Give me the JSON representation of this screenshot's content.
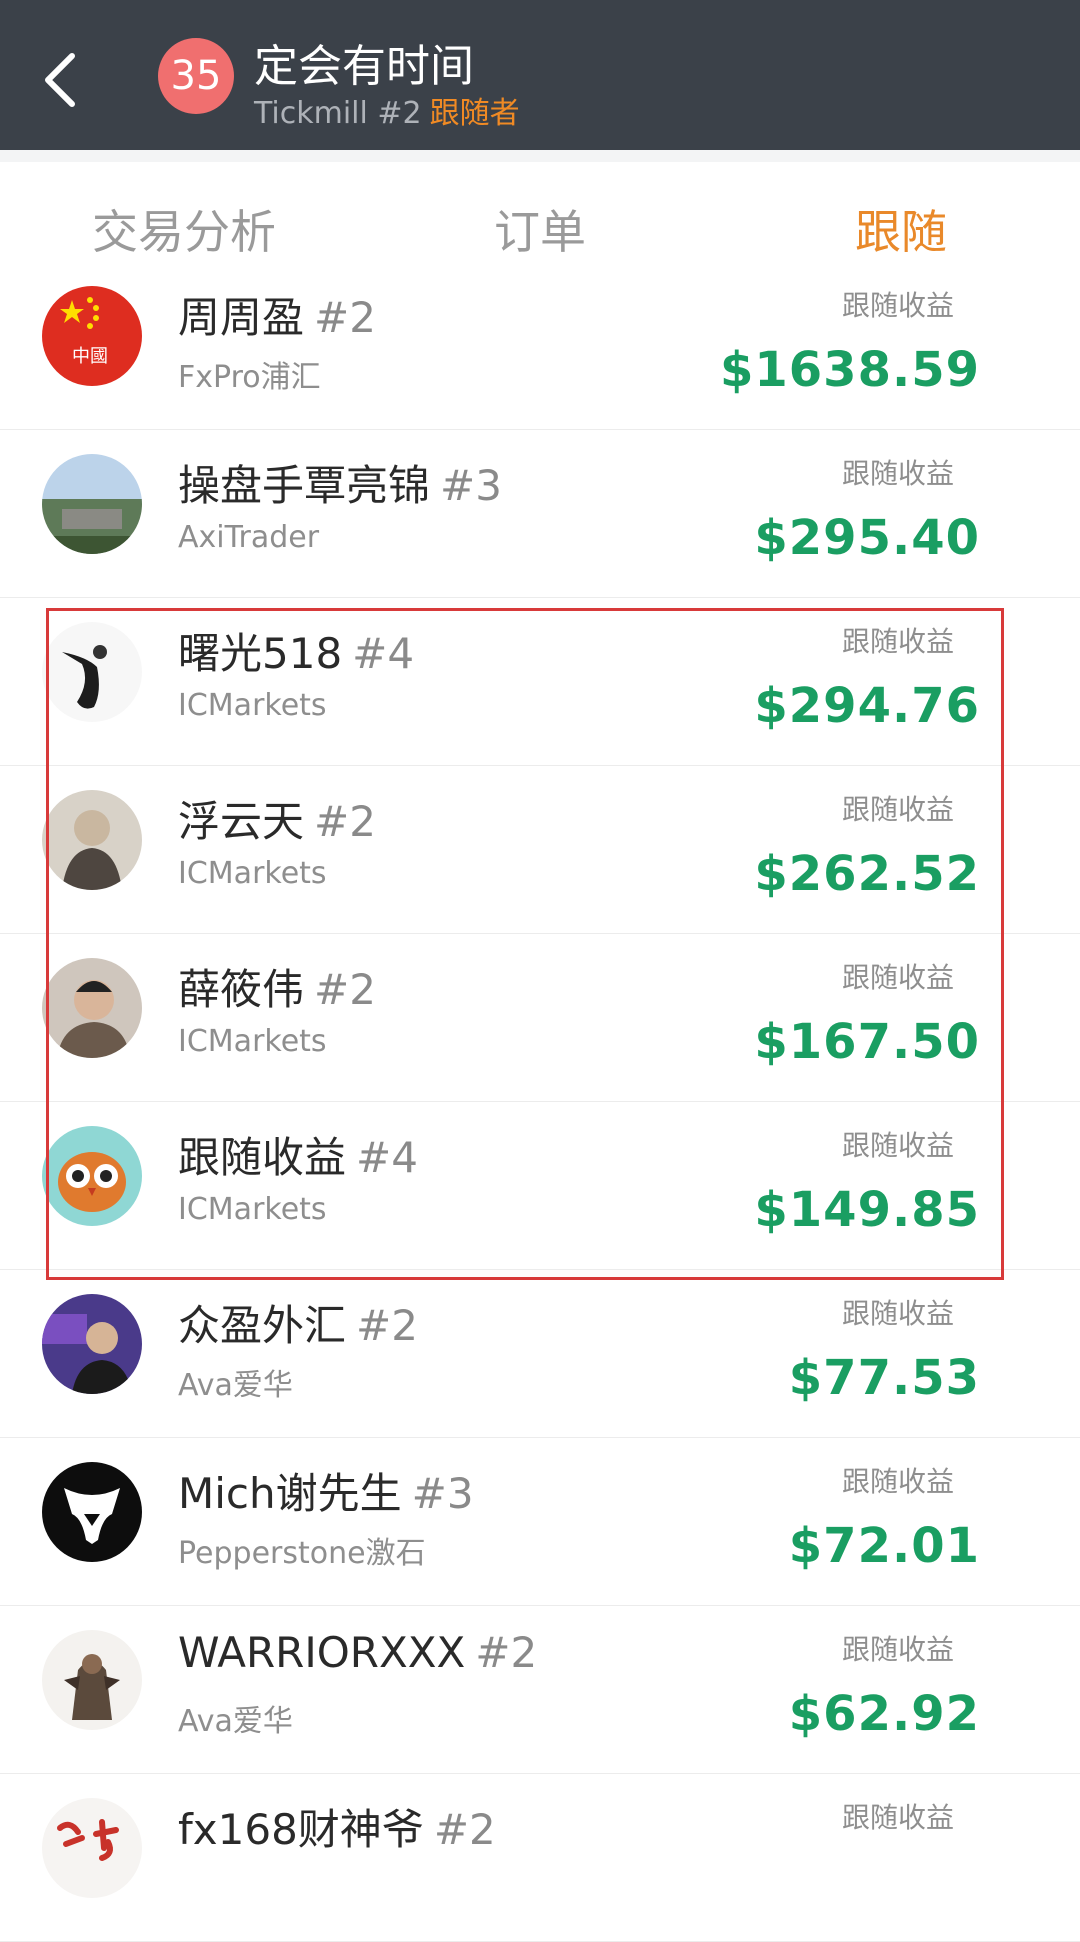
{
  "header": {
    "badge": "35",
    "title": "定会有时间",
    "subtitle": "Tickmill #2",
    "role": "跟随者"
  },
  "tabs": [
    {
      "label": "交易分析",
      "active": false
    },
    {
      "label": "订单",
      "active": false
    },
    {
      "label": "跟随",
      "active": true
    }
  ],
  "profit_label": "跟随收益",
  "rows": [
    {
      "name": "周周盈",
      "num": "#2",
      "broker": "FxPro浦汇",
      "profit": "$1638.59",
      "avatar_text": "中國"
    },
    {
      "name": "操盘手覃亮锦",
      "num": "#3",
      "broker": "AxiTrader",
      "profit": "$295.40"
    },
    {
      "name": "曙光518",
      "num": "#4",
      "broker": "ICMarkets",
      "profit": "$294.76"
    },
    {
      "name": "浮云天",
      "num": "#2",
      "broker": "ICMarkets",
      "profit": "$262.52"
    },
    {
      "name": "薛筱伟",
      "num": "#2",
      "broker": "ICMarkets",
      "profit": "$167.50"
    },
    {
      "name": "跟随收益",
      "num": "#4",
      "broker": "ICMarkets",
      "profit": "$149.85"
    },
    {
      "name": "众盈外汇",
      "num": "#2",
      "broker": "Ava爱华",
      "profit": "$77.53"
    },
    {
      "name": "Mich谢先生",
      "num": "#3",
      "broker": "Pepperstone激石",
      "profit": "$72.01"
    },
    {
      "name": "WARRIORXXX",
      "num": "#2",
      "broker": "Ava爱华",
      "profit": "$62.92"
    },
    {
      "name": "fx168财神爷",
      "num": "#2",
      "broker": "",
      "profit": ""
    }
  ],
  "colors": {
    "header_bg": "#3b4149",
    "accent": "#e9892a",
    "profit": "#1a9e62",
    "highlight": "#d83a3a"
  }
}
